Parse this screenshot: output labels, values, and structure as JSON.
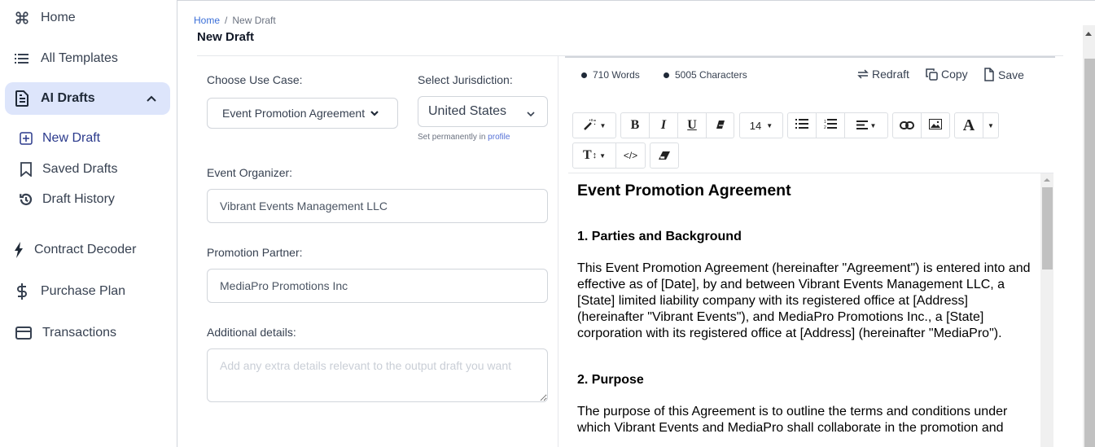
{
  "sidebar": {
    "items": [
      {
        "label": "Home",
        "icon": "command-icon"
      },
      {
        "label": "All Templates",
        "icon": "list-icon"
      },
      {
        "label": "AI Drafts",
        "icon": "document-icon",
        "expanded": true
      },
      {
        "label": "Contract Decoder",
        "icon": "lightning-icon"
      },
      {
        "label": "Purchase Plan",
        "icon": "dollar-icon"
      },
      {
        "label": "Transactions",
        "icon": "credit-card-icon"
      }
    ],
    "subitems": [
      {
        "label": "New Draft",
        "icon": "plus-square-icon",
        "active": true
      },
      {
        "label": "Saved Drafts",
        "icon": "bookmark-icon"
      },
      {
        "label": "Draft History",
        "icon": "history-icon"
      }
    ]
  },
  "header": {
    "breadcrumb": {
      "home": "Home",
      "separator": "/",
      "current": "New Draft"
    },
    "title": "New Draft"
  },
  "form": {
    "use_case": {
      "label": "Choose Use Case:",
      "value": "Event Promotion Agreement"
    },
    "jurisdiction": {
      "label": "Select Jurisdiction:",
      "value": "United States",
      "hint": "Set permanently in",
      "hint_link": "profile"
    },
    "organizer": {
      "label": "Event Organizer:",
      "value": "Vibrant Events Management LLC"
    },
    "partner": {
      "label": "Promotion Partner:",
      "value": "MediaPro Promotions Inc"
    },
    "details": {
      "label": "Additional details:",
      "placeholder": "Add any extra details relevant to the output draft you want",
      "value": ""
    }
  },
  "stats": {
    "words": "710 Words",
    "characters": "5005 Characters"
  },
  "actions": {
    "redraft": "Redraft",
    "copy": "Copy",
    "save": "Save"
  },
  "toolbar": {
    "font_size": "14",
    "bold": "B",
    "italic": "I",
    "underline": "U",
    "code": "</>",
    "font_color": "A",
    "text_style": "T"
  },
  "document": {
    "title": "Event Promotion Agreement",
    "sections": [
      {
        "heading": "1. Parties and Background",
        "body": "This Event Promotion Agreement (hereinafter \"Agreement\") is entered into and effective as of [Date], by and between Vibrant Events Management LLC, a [State] limited liability company with its registered office at [Address] (hereinafter \"Vibrant Events\"), and MediaPro Promotions Inc., a [State] corporation with its registered office at [Address] (hereinafter \"MediaPro\")."
      },
      {
        "heading": "2. Purpose",
        "body": "The purpose of this Agreement is to outline the terms and conditions under which Vibrant Events and MediaPro shall collaborate in the promotion and"
      }
    ]
  }
}
